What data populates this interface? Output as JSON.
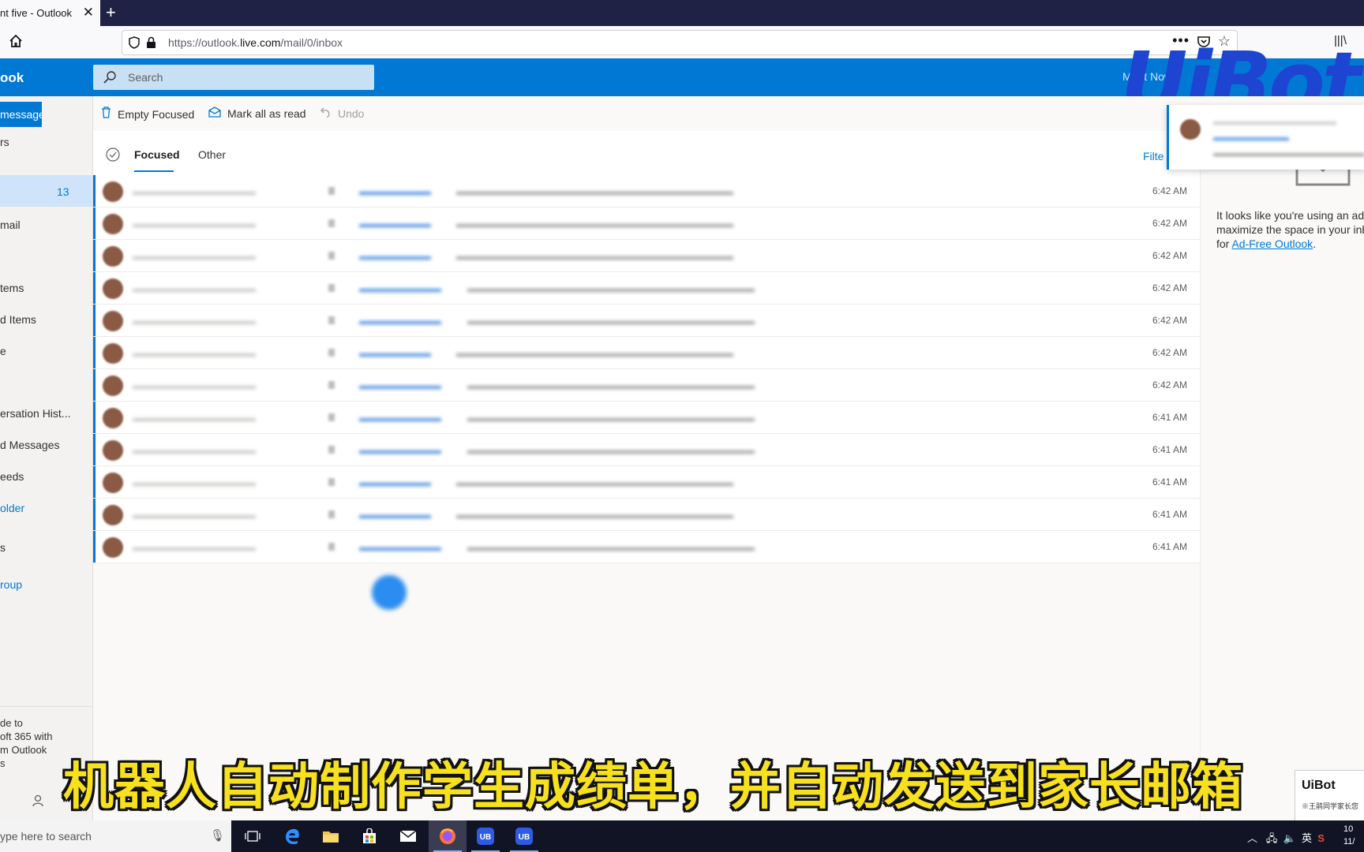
{
  "browser": {
    "tab_title": "nt five - Outlook",
    "close_glyph": "✕",
    "new_tab_glyph": "+",
    "url_prefix": "https://outlook.",
    "url_domain": "live.com",
    "url_path": "/mail/0/inbox",
    "page_actions_glyph": "•••"
  },
  "header": {
    "brand": "ook",
    "search_placeholder": "Search",
    "header_text": "Meet Now",
    "help": "?",
    "watermark": "UiBot"
  },
  "nav": {
    "new_message": "message",
    "items": [
      {
        "label": "rs"
      },
      {
        "label": "",
        "count": "13"
      },
      {
        "label": "mail"
      },
      {
        "label": "tems"
      },
      {
        "label": "d Items"
      },
      {
        "label": "e"
      },
      {
        "label": "ersation Hist..."
      },
      {
        "label": "d Messages"
      },
      {
        "label": "eeds"
      },
      {
        "label": "older"
      },
      {
        "label": "s"
      },
      {
        "label": "roup"
      }
    ],
    "upgrade_lines": [
      "de to",
      "oft 365 with",
      "m Outlook",
      "s"
    ]
  },
  "commands": {
    "empty_focused": "Empty Focused",
    "mark_all_read": "Mark all as read",
    "undo": "Undo"
  },
  "list": {
    "tab_focused": "Focused",
    "tab_other": "Other",
    "filter": "Filte",
    "rows": [
      {
        "time": "6:42 AM"
      },
      {
        "time": "6:42 AM"
      },
      {
        "time": "6:42 AM"
      },
      {
        "time": "6:42 AM"
      },
      {
        "time": "6:42 AM"
      },
      {
        "time": "6:42 AM"
      },
      {
        "time": "6:42 AM"
      },
      {
        "time": "6:41 AM"
      },
      {
        "time": "6:41 AM"
      },
      {
        "time": "6:41 AM"
      },
      {
        "time": "6:41 AM"
      },
      {
        "time": "6:41 AM"
      }
    ]
  },
  "ad": {
    "line1": "It looks like you're using an ad",
    "line2": "maximize the space in your inb",
    "line3_prefix": "for ",
    "link": "Ad-Free Outlook",
    "line3_suffix": "."
  },
  "caption": "机器人自动制作学生成绩单，并自动发送到家长邮箱",
  "ad_box": {
    "title": "UiBot",
    "sub": "※王鹃同学家长您"
  },
  "taskbar": {
    "search_placeholder": "ype here to search",
    "tray_ime": "英",
    "clock_line1": "10",
    "clock_line2": "11/"
  },
  "colors": {
    "accent": "#0078d4",
    "browser_dark": "#1f2145",
    "caption_yellow": "#f7e11e",
    "watermark_blue": "#1e44d2"
  }
}
